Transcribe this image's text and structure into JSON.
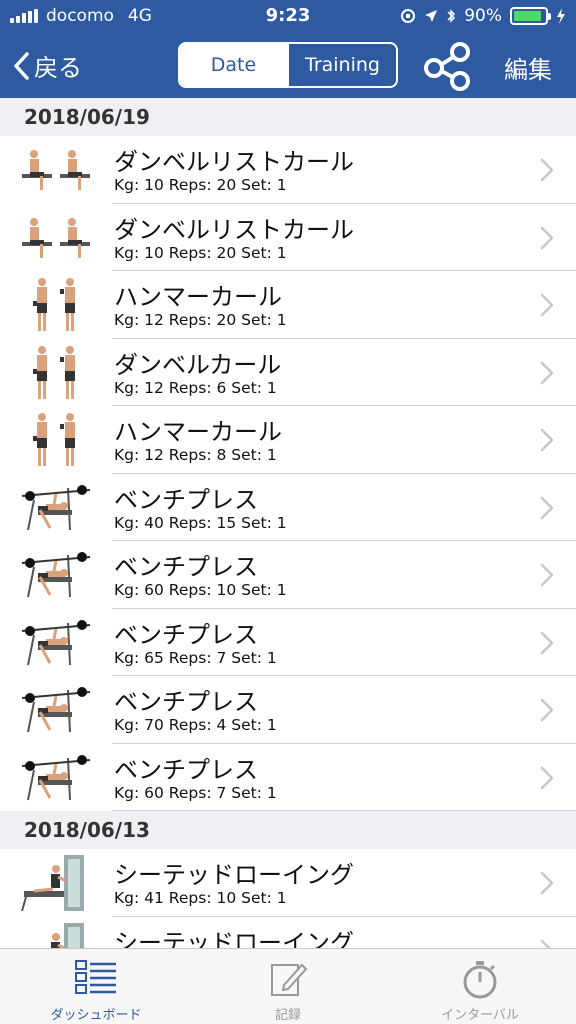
{
  "status_bar": {
    "carrier": "docomo",
    "network": "4G",
    "time": "9:23",
    "battery_percent": "90%",
    "battery_level": 0.9
  },
  "nav": {
    "back_label": "戻る",
    "segments": [
      "Date",
      "Training"
    ],
    "selected_segment": "Date",
    "edit_label": "編集"
  },
  "sections": [
    {
      "date": "2018/06/19",
      "rows": [
        {
          "name": "ダンベルリストカール",
          "detail": "Kg: 10 Reps: 20 Set: 1",
          "image": "wrist-curl"
        },
        {
          "name": "ダンベルリストカール",
          "detail": "Kg: 10 Reps: 20 Set: 1",
          "image": "wrist-curl"
        },
        {
          "name": "ハンマーカール",
          "detail": "Kg: 12 Reps: 20 Set: 1",
          "image": "standing-curl"
        },
        {
          "name": "ダンベルカール",
          "detail": "Kg: 12 Reps: 6 Set: 1",
          "image": "standing-curl"
        },
        {
          "name": "ハンマーカール",
          "detail": "Kg: 12 Reps: 8 Set: 1",
          "image": "standing-curl"
        },
        {
          "name": "ベンチプレス",
          "detail": "Kg: 40 Reps: 15 Set: 1",
          "image": "bench-press"
        },
        {
          "name": "ベンチプレス",
          "detail": "Kg: 60 Reps: 10 Set: 1",
          "image": "bench-press"
        },
        {
          "name": "ベンチプレス",
          "detail": "Kg: 65 Reps: 7 Set: 1",
          "image": "bench-press"
        },
        {
          "name": "ベンチプレス",
          "detail": "Kg: 70 Reps: 4 Set: 1",
          "image": "bench-press"
        },
        {
          "name": "ベンチプレス",
          "detail": "Kg: 60 Reps: 7 Set: 1",
          "image": "bench-press"
        }
      ]
    },
    {
      "date": "2018/06/13",
      "rows": [
        {
          "name": "シーテッドローイング",
          "detail": "Kg: 41 Reps: 10 Set: 1",
          "image": "seated-row"
        },
        {
          "name": "シーテッドローイング",
          "detail": "",
          "image": "seated-row"
        }
      ]
    }
  ],
  "tabs": [
    {
      "label": "ダッシュボード",
      "icon": "dashboard-icon",
      "active": true
    },
    {
      "label": "記録",
      "icon": "record-edit-icon",
      "active": false
    },
    {
      "label": "インターバル",
      "icon": "stopwatch-icon",
      "active": false
    }
  ],
  "colors": {
    "accent": "#2d5aa0",
    "battery": "#4cd964",
    "section_bg": "#efeff4",
    "tab_inactive": "#999999"
  }
}
